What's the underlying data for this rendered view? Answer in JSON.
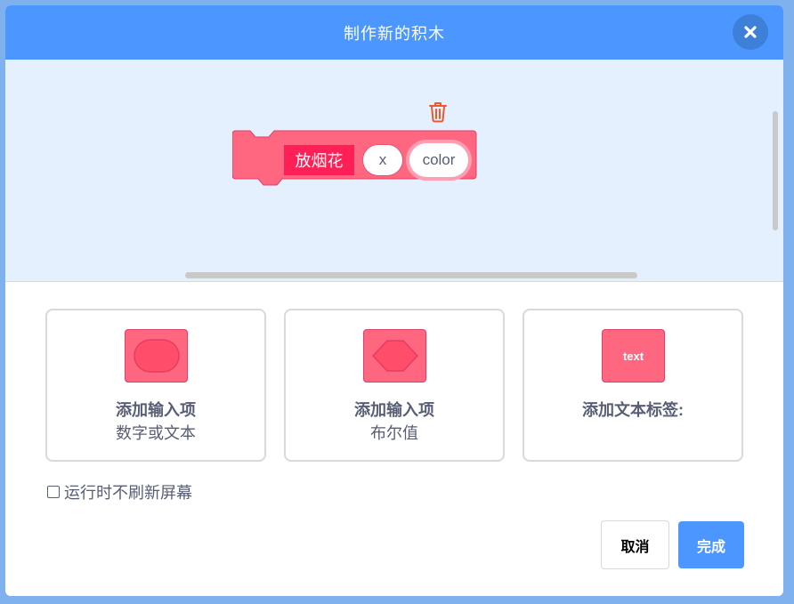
{
  "dialog": {
    "title": "制作新的积木",
    "close_icon": "close-icon"
  },
  "workspace": {
    "trash_icon": "trash-icon",
    "block": {
      "name": "放烟花",
      "args": [
        "x",
        "color"
      ],
      "color": "#ff6680"
    }
  },
  "options": [
    {
      "id": "number-text",
      "line1": "添加输入项",
      "line2": "数字或文本",
      "icon": "round-input-icon"
    },
    {
      "id": "boolean",
      "line1": "添加输入项",
      "line2": "布尔值",
      "icon": "hexagon-input-icon"
    },
    {
      "id": "label",
      "line1": "添加文本标签:",
      "line2": "",
      "icon": "text-label-icon",
      "preview_text": "text"
    }
  ],
  "checkbox": {
    "label": "运行时不刷新屏幕",
    "checked": false
  },
  "buttons": {
    "cancel": "取消",
    "ok": "完成"
  },
  "colors": {
    "header": "#4c97ff",
    "workspace": "#e5f0ff",
    "block": "#ff6680",
    "block_label": "#ff1f57",
    "trash": "#ec5a2a"
  }
}
